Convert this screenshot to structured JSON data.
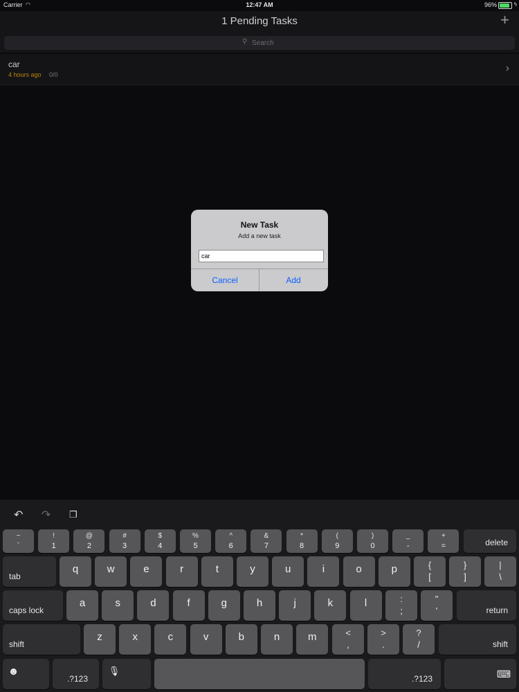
{
  "status": {
    "carrier": "Carrier",
    "time": "12:47 AM",
    "battery_pct": "96%",
    "battery_level": 0.96
  },
  "nav": {
    "title": "1 Pending Tasks",
    "add_icon": "plus-icon"
  },
  "search": {
    "placeholder": "Search"
  },
  "task": {
    "title": "car",
    "time": "4 hours ago",
    "count": "0/0"
  },
  "dialog": {
    "title": "New Task",
    "message": "Add a new task",
    "input_value": "car",
    "cancel": "Cancel",
    "add": "Add"
  },
  "keyboard": {
    "number_row": [
      {
        "top": "~",
        "bottom": "`"
      },
      {
        "top": "!",
        "bottom": "1"
      },
      {
        "top": "@",
        "bottom": "2"
      },
      {
        "top": "#",
        "bottom": "3"
      },
      {
        "top": "$",
        "bottom": "4"
      },
      {
        "top": "%",
        "bottom": "5"
      },
      {
        "top": "^",
        "bottom": "6"
      },
      {
        "top": "&",
        "bottom": "7"
      },
      {
        "top": "*",
        "bottom": "8"
      },
      {
        "top": "(",
        "bottom": "9"
      },
      {
        "top": ")",
        "bottom": "0"
      },
      {
        "top": "_",
        "bottom": "-"
      },
      {
        "top": "+",
        "bottom": "="
      }
    ],
    "delete": "delete",
    "tab": "tab",
    "row_q": [
      "q",
      "w",
      "e",
      "r",
      "t",
      "y",
      "u",
      "i",
      "o",
      "p"
    ],
    "row_q_extra": [
      {
        "top": "{",
        "bottom": "["
      },
      {
        "top": "}",
        "bottom": "]"
      },
      {
        "top": "|",
        "bottom": "\\"
      }
    ],
    "caps_lock": "caps lock",
    "row_a": [
      "a",
      "s",
      "d",
      "f",
      "g",
      "h",
      "j",
      "k",
      "l"
    ],
    "row_a_extra": [
      {
        "top": ":",
        "bottom": ";"
      },
      {
        "top": "\"",
        "bottom": "'"
      }
    ],
    "return": "return",
    "shift": "shift",
    "row_z": [
      "z",
      "x",
      "c",
      "v",
      "b",
      "n",
      "m"
    ],
    "row_z_extra": [
      {
        "top": "<",
        "bottom": ","
      },
      {
        "top": ">",
        "bottom": "."
      },
      {
        "top": "?",
        "bottom": "/"
      }
    ],
    "numbers_left": ".?123",
    "numbers_right": ".?123"
  }
}
